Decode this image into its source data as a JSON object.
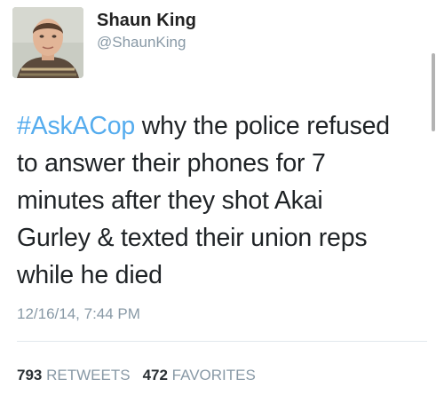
{
  "author": {
    "display_name": "Shaun King",
    "username": "@ShaunKing"
  },
  "tweet": {
    "hashtag": "#AskACop",
    "lines": [
      " why the police refused",
      "to answer their phones for 7",
      "minutes after they shot Akai",
      "Gurley & texted their union reps",
      "while he died"
    ],
    "timestamp": "12/16/14, 7:44 PM"
  },
  "stats": {
    "retweets_count": "793",
    "retweets_label": "RETWEETS",
    "favorites_count": "472",
    "favorites_label": "FAVORITES"
  },
  "colors": {
    "hashtag": "#55acee",
    "meta_text": "#8899a6",
    "divider": "#e1e8ed"
  }
}
